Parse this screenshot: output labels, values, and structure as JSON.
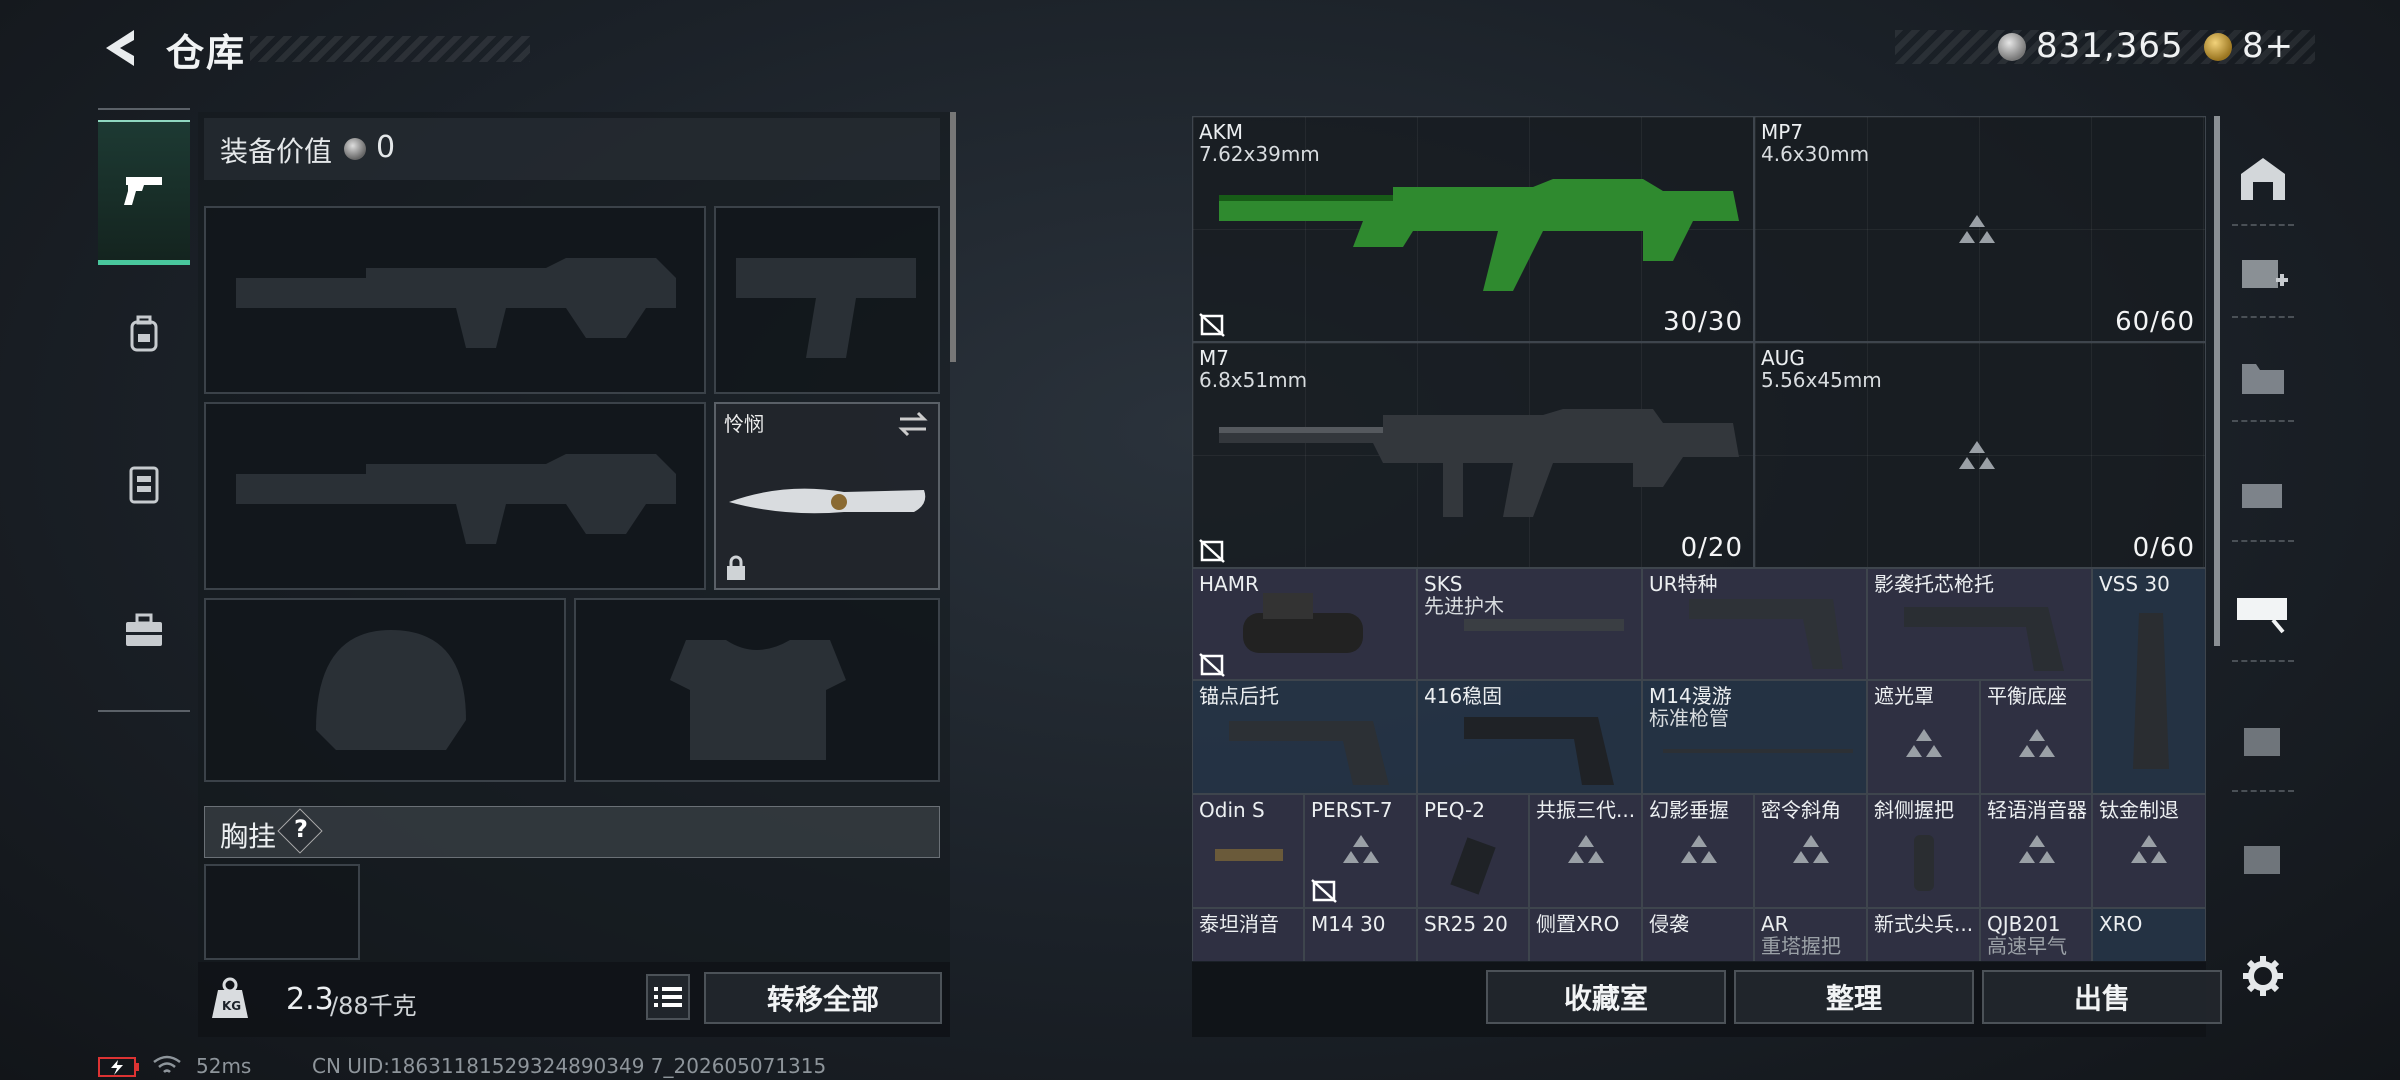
{
  "header": {
    "title": "仓库"
  },
  "currency": {
    "coins": "831,365",
    "tickets": "8+"
  },
  "left_nav": [
    {
      "name": "nav-weapon"
    },
    {
      "name": "nav-backpack"
    },
    {
      "name": "nav-vest"
    },
    {
      "name": "nav-case"
    }
  ],
  "loadout": {
    "value_label": "装备价值",
    "value": "0",
    "melee_name": "怜悯",
    "chest_label": "胸挂",
    "help": "?"
  },
  "bottom_left": {
    "weight": "2.3",
    "weight_max": "/88千克",
    "transfer_all": "转移全部"
  },
  "bottom_right": {
    "collection": "收藏室",
    "sort": "整理",
    "sell": "出售"
  },
  "stash": {
    "weapons": [
      {
        "name": "AKM",
        "caliber": "7.62x39mm",
        "ammo": "30/30"
      },
      {
        "name": "MP7",
        "caliber": "4.6x30mm",
        "ammo": "60/60"
      },
      {
        "name": "M7",
        "caliber": "6.8x51mm",
        "ammo": "0/20"
      },
      {
        "name": "AUG",
        "caliber": "5.56x45mm",
        "ammo": "0/60"
      }
    ],
    "row1": [
      "HAMR",
      "SKS",
      "先进护木",
      "UR特种",
      "影袭托芯枪托",
      "VSS 30"
    ],
    "row2": [
      "锚点后托",
      "416稳固",
      "M14漫游",
      "标准枪管",
      "遮光罩",
      "平衡底座"
    ],
    "row3": [
      "Odin S",
      "PERST-7",
      "PEQ-2",
      "共振三代...",
      "幻影垂握",
      "密令斜角",
      "斜侧握把",
      "轻语消音器",
      "钛金制退"
    ],
    "row4": [
      "泰坦消音",
      "M14 30",
      "SR25 20",
      "侧置XRO",
      "侵袭",
      "AR",
      "重塔握把",
      "新式尖兵...",
      "QJB201",
      "高速早气",
      "XRO"
    ]
  },
  "status": {
    "ping": "52ms",
    "uid": "CN UID:18631181529324890349 7_202605071315"
  },
  "colors": {
    "accent": "#49c79d",
    "panel": "#1a1f25"
  }
}
